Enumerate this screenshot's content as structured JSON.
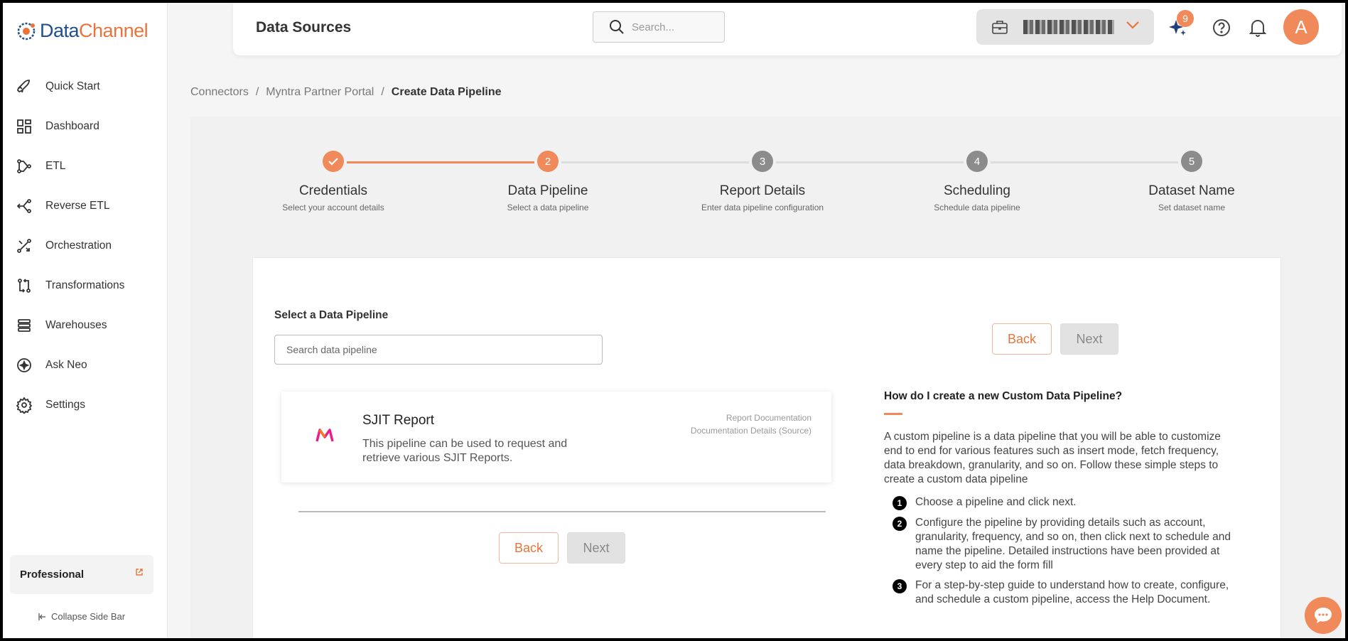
{
  "brand": {
    "logo_text_a": "Data",
    "logo_text_b": "Channel"
  },
  "sidebar": {
    "items": [
      {
        "label": "Quick Start",
        "icon": "rocket-icon"
      },
      {
        "label": "Dashboard",
        "icon": "dashboard-icon"
      },
      {
        "label": "ETL",
        "icon": "etl-icon"
      },
      {
        "label": "Reverse ETL",
        "icon": "reverse-etl-icon"
      },
      {
        "label": "Orchestration",
        "icon": "orchestration-icon"
      },
      {
        "label": "Transformations",
        "icon": "transformations-icon"
      },
      {
        "label": "Warehouses",
        "icon": "warehouses-icon"
      },
      {
        "label": "Ask Neo",
        "icon": "ask-neo-icon"
      },
      {
        "label": "Settings",
        "icon": "gear-icon"
      }
    ],
    "plan": "Professional",
    "collapse_label": "Collapse Side Bar"
  },
  "header": {
    "title": "Data Sources",
    "search_placeholder": "Search...",
    "notifications_count": "9",
    "avatar_initial": "A"
  },
  "breadcrumb": {
    "items": [
      "Connectors",
      "Myntra Partner Portal"
    ],
    "current": "Create Data Pipeline"
  },
  "steps": [
    {
      "num": "",
      "title": "Credentials",
      "sub": "Select your account details",
      "state": "done"
    },
    {
      "num": "2",
      "title": "Data Pipeline",
      "sub": "Select a data pipeline",
      "state": "active"
    },
    {
      "num": "3",
      "title": "Report Details",
      "sub": "Enter data pipeline configuration",
      "state": "pending"
    },
    {
      "num": "4",
      "title": "Scheduling",
      "sub": "Schedule data pipeline",
      "state": "pending"
    },
    {
      "num": "5",
      "title": "Dataset Name",
      "sub": "Set dataset name",
      "state": "pending"
    }
  ],
  "colors": {
    "accent": "#f08a5a",
    "pending": "#8c8c8c"
  },
  "form": {
    "label": "Select a Data Pipeline",
    "search_placeholder": "Search data pipeline",
    "back_label": "Back",
    "next_label": "Next"
  },
  "pipeline": {
    "name": "SJIT Report",
    "description": "This pipeline can be used to request and retrieve various SJIT Reports.",
    "link1": "Report Documentation",
    "link2": "Documentation Details (Source)"
  },
  "help": {
    "title": "How do I create a new Custom Data Pipeline?",
    "body": "A custom pipeline is a data pipeline that you will be able to customize end to end for various features such as insert mode, fetch frequency, data breakdown, granularity, and so on. Follow these simple steps to create a custom data pipeline",
    "steps": [
      {
        "num": "1",
        "text": "Choose a pipeline and click next."
      },
      {
        "num": "2",
        "text": "Configure the pipeline by providing details such as account, granularity, frequency, and so on, then click next to schedule and name the pipeline. Detailed instructions have been provided at every step to aid the form fill"
      },
      {
        "num": "3",
        "text": "For a step-by-step guide to understand how to create, configure, and schedule a custom pipeline, access the Help Document."
      }
    ]
  }
}
